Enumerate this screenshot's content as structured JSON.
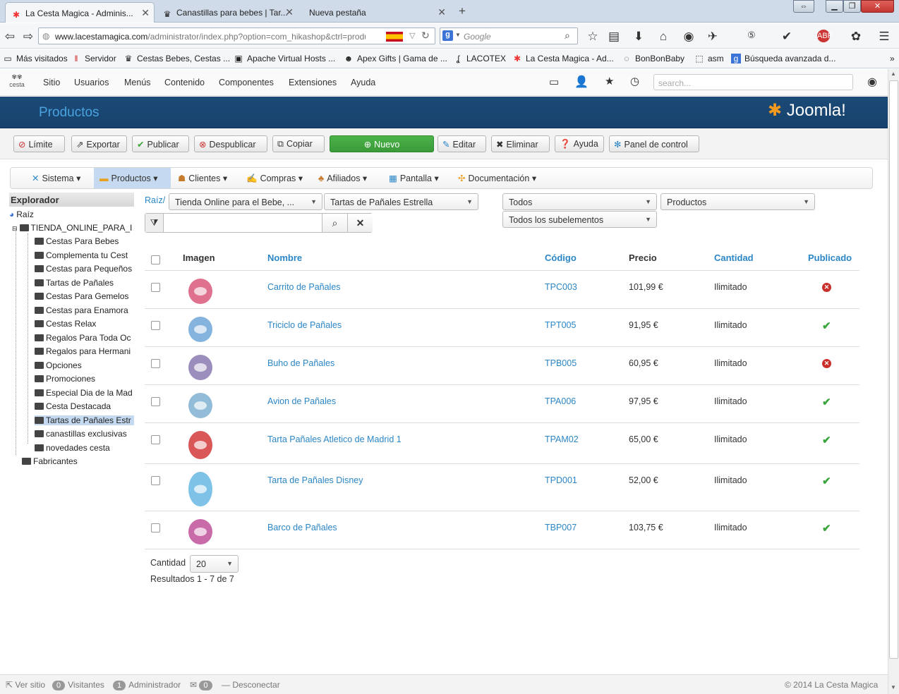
{
  "browser": {
    "tabs": [
      {
        "title": "La Cesta Magica - Adminis...",
        "icon": "joomla-icon"
      },
      {
        "title": "Canastillas para bebes | Tar...",
        "icon": "crown-icon"
      },
      {
        "title": "Nueva pestaña",
        "icon": ""
      }
    ],
    "url_prefix": "www.lacestamagica.com",
    "url_path": "/administrator/index.php?option=com_hikashop&ctrl=produc",
    "search_engine": "Google",
    "bookmarks": [
      "Más visitados",
      "Servidor",
      "Cestas Bebes, Cestas ...",
      "Apache Virtual Hosts ...",
      "Apex Gifts | Gama de ...",
      "LACOTEX",
      "La Cesta Magica - Ad...",
      "BonBonBaby",
      "asm",
      "Búsqueda avanzada d..."
    ]
  },
  "admin_menu": {
    "items": [
      "Sitio",
      "Usuarios",
      "Menús",
      "Contenido",
      "Componentes",
      "Extensiones",
      "Ayuda"
    ],
    "search_placeholder": "search..."
  },
  "header": {
    "title": "Productos",
    "brand": "Joomla!"
  },
  "toolbar": {
    "limit": "Límite",
    "export": "Exportar",
    "publish": "Publicar",
    "unpublish": "Despublicar",
    "copy": "Copiar",
    "new": "Nuevo",
    "edit": "Editar",
    "delete": "Eliminar",
    "help": "Ayuda",
    "control_panel": "Panel de control"
  },
  "hika_menu": [
    "Sistema",
    "Productos",
    "Clientes",
    "Compras",
    "Afiliados",
    "Pantalla",
    "Documentación"
  ],
  "explorer": {
    "title": "Explorador",
    "root": "Raíz",
    "store": "TIENDA_ONLINE_PARA_I",
    "categories": [
      "Cestas Para Bebes",
      "Complementa tu Cest",
      "Cestas para Pequeños",
      "Tartas de Pañales",
      "Cestas Para Gemelos",
      "Cestas para Enamora",
      "Cestas Relax",
      "Regalos Para Toda Oc",
      "Regalos para Hermani",
      "Opciones",
      "Promociones",
      "Especial Dia de la Mad",
      "Cesta Destacada",
      "Tartas de Pañales Estr",
      "canastillas exclusivas",
      "novedades cesta"
    ],
    "manufacturers": "Fabricantes"
  },
  "filters": {
    "breadcrumb_root": "Raíz/",
    "cat1": "Tienda Online para el Bebe, ...",
    "cat2": "Tartas de Pañales Estrella",
    "status": "Todos",
    "type": "Productos",
    "sub": "Todos los subelementos"
  },
  "table": {
    "headers": {
      "image": "Imagen",
      "name": "Nombre",
      "code": "Código",
      "price": "Precio",
      "quantity": "Cantidad",
      "published": "Publicado"
    },
    "rows": [
      {
        "name": "Carrito de Pañales",
        "code": "TPC003",
        "price": "101,99 €",
        "quantity": "Ilimitado",
        "published": false,
        "thumb_color": "#d9577a"
      },
      {
        "name": "Triciclo de Pañales",
        "code": "TPT005",
        "price": "91,95 €",
        "quantity": "Ilimitado",
        "published": true,
        "thumb_color": "#6fa6d8"
      },
      {
        "name": "Buho de Pañales",
        "code": "TPB005",
        "price": "60,95 €",
        "quantity": "Ilimitado",
        "published": false,
        "thumb_color": "#8a7ab0"
      },
      {
        "name": "Avion de Pañales",
        "code": "TPA006",
        "price": "97,95 €",
        "quantity": "Ilimitado",
        "published": true,
        "thumb_color": "#7fb0d0"
      },
      {
        "name": "Tarta Pañales Atletico de Madrid 1",
        "code": "TPAM02",
        "price": "65,00 €",
        "quantity": "Ilimitado",
        "published": true,
        "thumb_color": "#d23a3a"
      },
      {
        "name": "Tarta de Pañales Disney",
        "code": "TPD001",
        "price": "52,00 €",
        "quantity": "Ilimitado",
        "published": true,
        "thumb_color": "#69b7e3"
      },
      {
        "name": "Barco de Pañales",
        "code": "TBP007",
        "price": "103,75 €",
        "quantity": "Ilimitado",
        "published": true,
        "thumb_color": "#c0509a"
      }
    ]
  },
  "pagination": {
    "label": "Cantidad",
    "value": "20",
    "results": "Resultados 1 - 7 de 7"
  },
  "footer": {
    "view_site": "Ver sitio",
    "visitors_count": "0",
    "visitors": "Visitantes",
    "admin_count": "1",
    "admin": "Administrador",
    "msg_count": "0",
    "logout": "Desconectar",
    "copyright": "© 2014 La Cesta Magica"
  }
}
